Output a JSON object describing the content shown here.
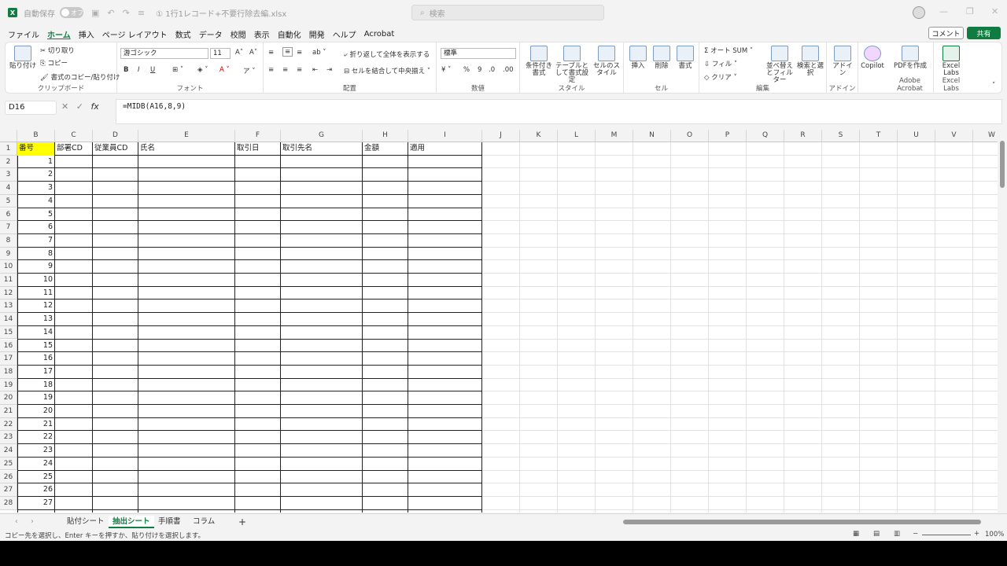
{
  "title_bar": {
    "autosave_label": "自動保存",
    "autosave_state": "オフ",
    "doc_title": "① 1行1レコード+不要行除去編.xlsx",
    "search_placeholder": "検索"
  },
  "menu": {
    "tabs": [
      "ファイル",
      "ホーム",
      "挿入",
      "ページ レイアウト",
      "数式",
      "データ",
      "校閲",
      "表示",
      "自動化",
      "開発",
      "ヘルプ",
      "Acrobat"
    ],
    "active_index": 1,
    "comment_label": "コメント",
    "share_label": "共有"
  },
  "ribbon": {
    "clipboard": {
      "paste": "貼り付け",
      "cut": "切り取り",
      "copy": "コピー",
      "format_painter": "書式のコピー/貼り付け",
      "label": "クリップボード"
    },
    "font": {
      "name": "游ゴシック",
      "size": "11",
      "bold": "B",
      "italic": "I",
      "underline": "U",
      "label": "フォント"
    },
    "alignment": {
      "wrap": "折り返して全体を表示する",
      "merge": "セルを結合して中央揃え",
      "label": "配置"
    },
    "number": {
      "format": "標準",
      "label": "数値"
    },
    "styles": {
      "conditional": "条件付き書式",
      "table": "テーブルとして書式設定",
      "cell_styles": "セルのスタイル",
      "label": "スタイル"
    },
    "cells": {
      "insert": "挿入",
      "delete": "削除",
      "format": "書式",
      "label": "セル"
    },
    "editing": {
      "autosum": "オート SUM",
      "fill": "フィル",
      "clear": "クリア",
      "sort": "並べ替えとフィルター",
      "find": "検索と選択",
      "label": "編集"
    },
    "addins": {
      "addin": "アドイン",
      "label": "アドイン"
    },
    "copilot": {
      "label": "Copilot"
    },
    "acrobat": {
      "pdf": "PDFを作成",
      "label": "Adobe Acrobat"
    },
    "labs": {
      "label": "Excel Labs",
      "btn": "Excel Labs"
    }
  },
  "formula_bar": {
    "name_box": "D16",
    "formula": "=MIDB(A16,8,9)"
  },
  "grid": {
    "columns": [
      "B",
      "C",
      "D",
      "E",
      "F",
      "G",
      "H",
      "I",
      "J",
      "K",
      "L",
      "M",
      "N",
      "O",
      "P",
      "Q",
      "R",
      "S",
      "T",
      "U",
      "V",
      "W"
    ],
    "header_row": [
      "番号",
      "部署CD",
      "従業員CD",
      "氏名",
      "取引日",
      "取引先名",
      "金額",
      "適用"
    ],
    "rows": [
      "1",
      "2",
      "3",
      "4",
      "5",
      "6",
      "7",
      "8",
      "9",
      "10",
      "11",
      "12",
      "13",
      "14",
      "15",
      "16",
      "17",
      "18",
      "19",
      "20",
      "21",
      "22",
      "23",
      "24",
      "25",
      "26",
      "27",
      "28"
    ],
    "numbers": [
      "1",
      "2",
      "3",
      "4",
      "5",
      "6",
      "7",
      "8",
      "9",
      "10",
      "11",
      "12",
      "13",
      "14",
      "15",
      "16",
      "17",
      "18",
      "19",
      "20",
      "21",
      "22",
      "23",
      "24",
      "25",
      "26",
      "27"
    ]
  },
  "sheets": {
    "tabs": [
      "貼付シート",
      "抽出シート",
      "手順書",
      "コラム"
    ],
    "active_index": 1
  },
  "status": {
    "message": "コピー先を選択し、Enter キーを押すか、貼り付けを選択します。",
    "zoom": "100%"
  },
  "colors": {
    "accent": "#107c41",
    "highlight": "#ffff00"
  }
}
